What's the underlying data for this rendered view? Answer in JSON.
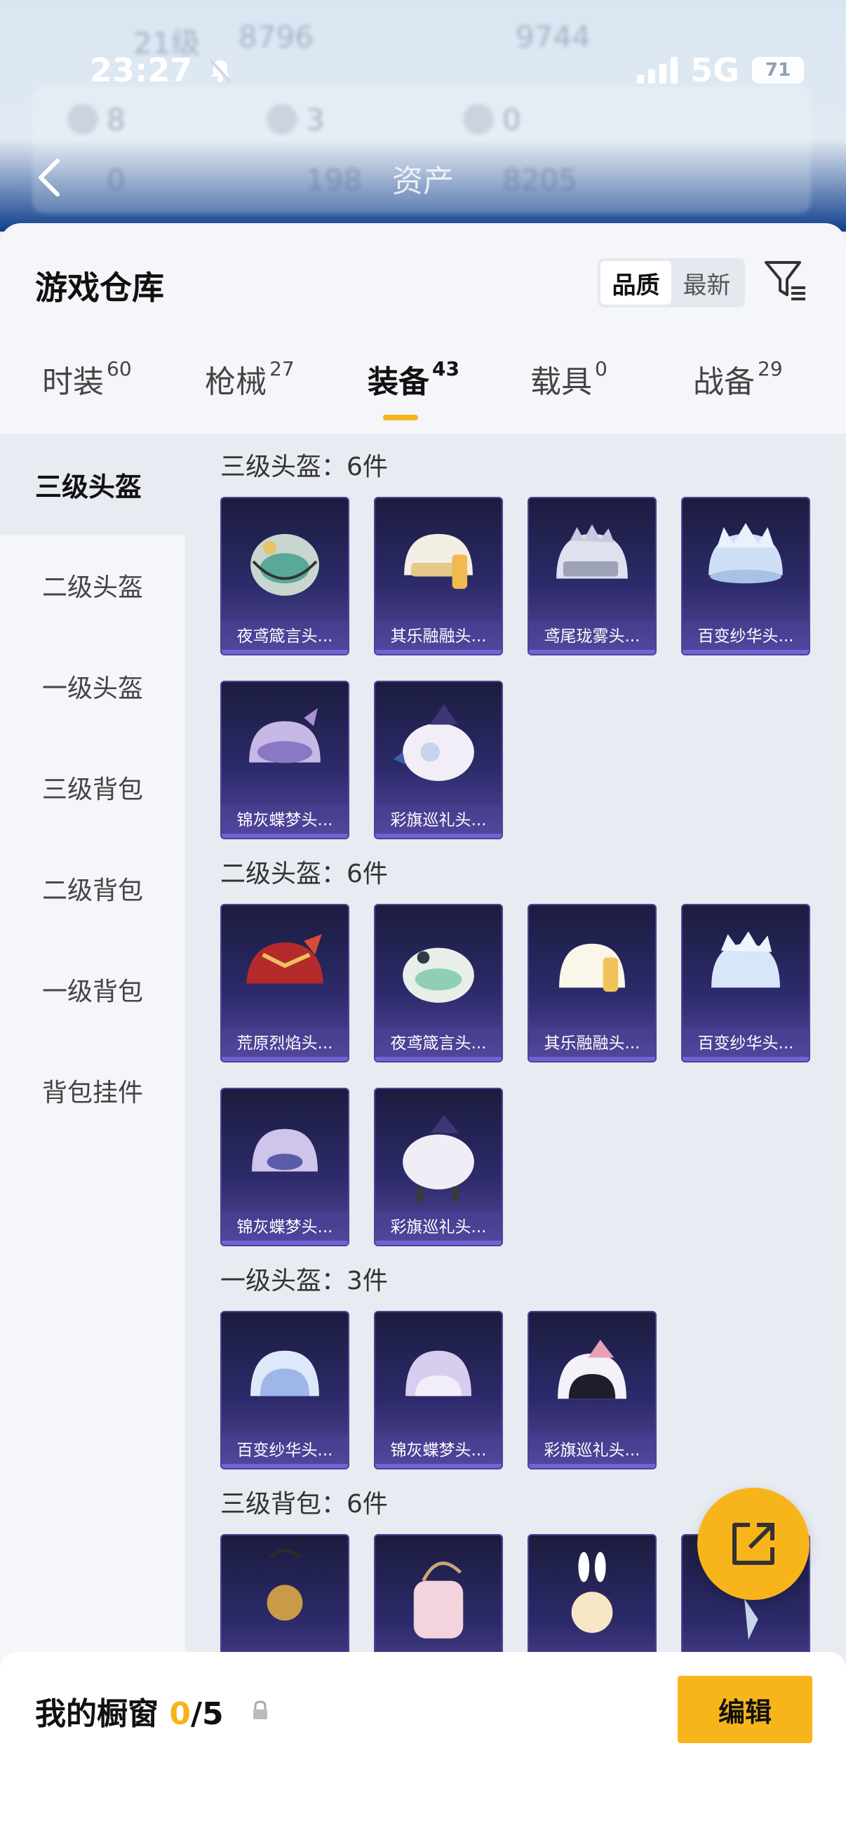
{
  "status_bar": {
    "time": "23:27",
    "network": "5G",
    "battery": "71"
  },
  "background_header": {
    "title": "资产",
    "level_text": "21级",
    "score_left": "8796",
    "score_right": "9744",
    "stats_row1": [
      "8",
      "3",
      "0"
    ],
    "stats_row2": [
      "0",
      "198",
      "8205"
    ]
  },
  "sheet": {
    "title": "游戏仓库",
    "sort_options": [
      "品质",
      "最新"
    ],
    "active_sort": "品质"
  },
  "tabs": [
    {
      "label": "时装",
      "count": "60"
    },
    {
      "label": "枪械",
      "count": "27"
    },
    {
      "label": "装备",
      "count": "43"
    },
    {
      "label": "载具",
      "count": "0"
    },
    {
      "label": "战备",
      "count": "29"
    }
  ],
  "active_tab": "装备",
  "sidebar": [
    {
      "label": "三级头盔",
      "active": true
    },
    {
      "label": "二级头盔"
    },
    {
      "label": "一级头盔"
    },
    {
      "label": "三级背包"
    },
    {
      "label": "二级背包"
    },
    {
      "label": "一级背包"
    },
    {
      "label": "背包挂件"
    }
  ],
  "sections": [
    {
      "title": "三级头盔：6件",
      "items": [
        "夜鸢箴言头...",
        "其乐融融头...",
        "鸢尾珑雾头...",
        "百变纱华头...",
        "锦灰蝶梦头...",
        "彩旗巡礼头..."
      ]
    },
    {
      "title": "二级头盔：6件",
      "items": [
        "荒原烈焰头...",
        "夜鸢箴言头...",
        "其乐融融头...",
        "百变纱华头...",
        "锦灰蝶梦头...",
        "彩旗巡礼头..."
      ]
    },
    {
      "title": "一级头盔：3件",
      "items": [
        "百变纱华头...",
        "锦灰蝶梦头...",
        "彩旗巡礼头..."
      ]
    },
    {
      "title": "三级背包：6件",
      "items": [
        "",
        "",
        "",
        ""
      ]
    }
  ],
  "bottom": {
    "label": "我的橱窗",
    "count": "0",
    "total": "/5",
    "edit_label": "编辑"
  },
  "colors": {
    "accent": "#f8b51b",
    "card_bg": "#2c2a6a",
    "sheet_bg": "#f4f6fa"
  }
}
